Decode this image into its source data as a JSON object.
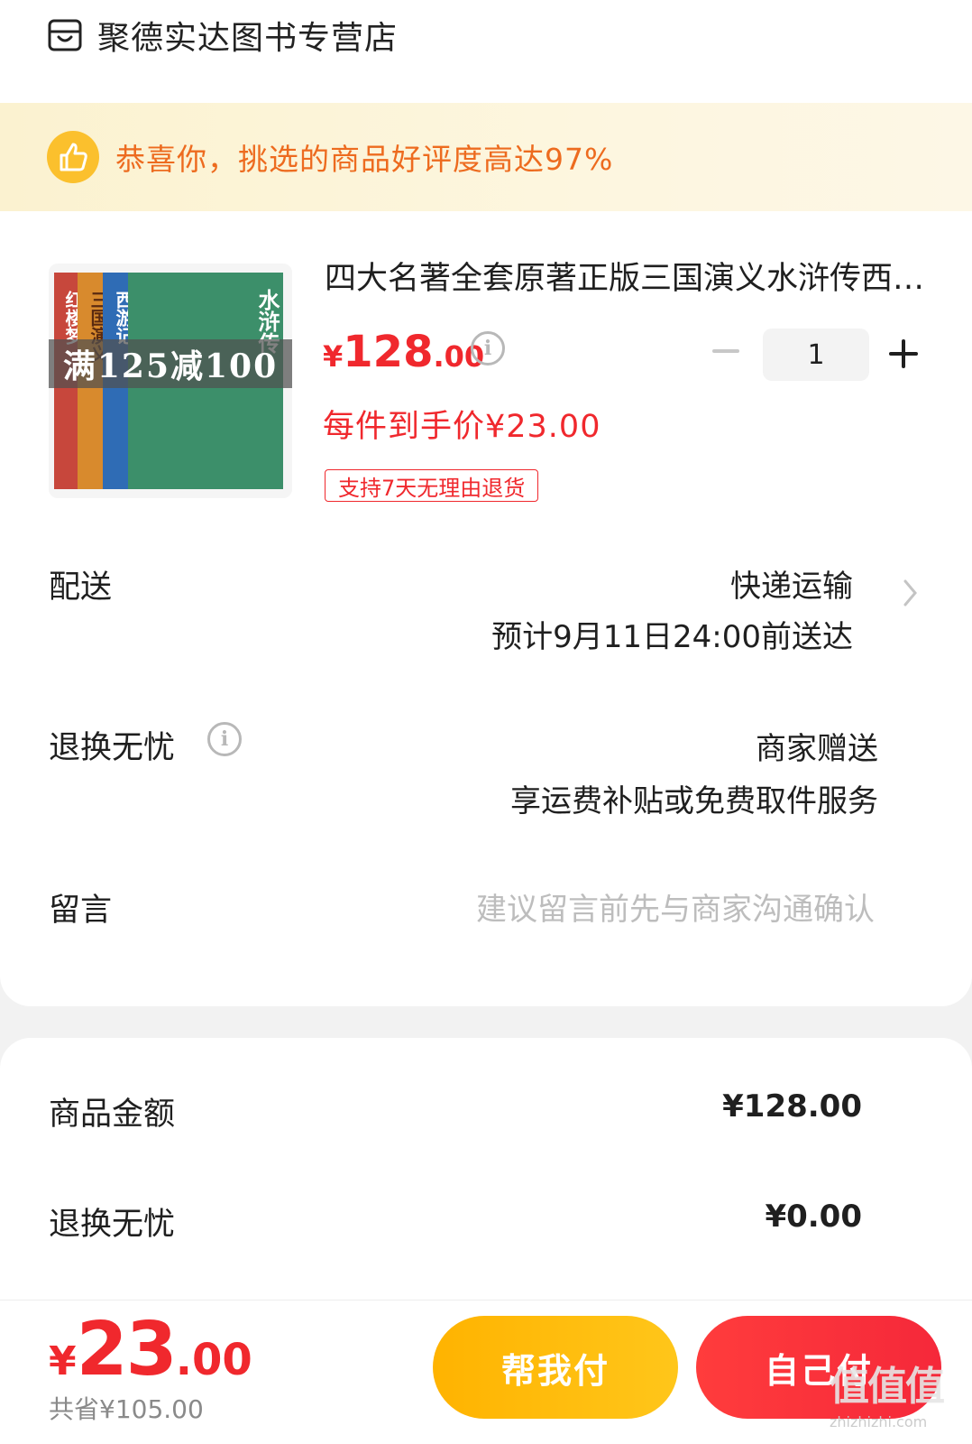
{
  "shop": {
    "name": "聚德实达图书专营店",
    "icon": "store-icon"
  },
  "banner": {
    "text": "恭喜你，挑选的商品好评度高达97%",
    "icon": "thumbs-up-icon"
  },
  "product": {
    "title": "四大名著全套原著正版三国演义水浒传西游记红楼梦",
    "promo_tag": "满125减100",
    "book_titles": [
      "红楼梦",
      "三国演义",
      "西游记",
      "水浒传"
    ],
    "price_symbol": "¥",
    "price_int": "128",
    "price_dec": ".00",
    "price_info_icon": "i",
    "quantity": "1",
    "unit_price_text": "每件到手价¥23.00",
    "return_tag": "支持7天无理由退货"
  },
  "delivery": {
    "label": "配送",
    "method": "快递运输",
    "estimate": "预计9月11日24:00前送达"
  },
  "return_service": {
    "label": "退换无忧",
    "info_icon": "i",
    "value": "商家赠送",
    "detail": "享运费补贴或免费取件服务"
  },
  "message": {
    "label": "留言",
    "placeholder": "建议留言前先与商家沟通确认"
  },
  "summary": {
    "items": [
      {
        "label": "商品金额",
        "value": "¥128.00"
      },
      {
        "label": "退换无忧",
        "value": "¥0.00"
      }
    ]
  },
  "footer": {
    "total_symbol": "¥",
    "total_int": "23",
    "total_dec": ".00",
    "saved": "共省¥105.00",
    "btn_help": "帮我付",
    "btn_self": "自己付"
  },
  "watermark": {
    "logo": "值值值",
    "url": "zhizhizhi.com"
  },
  "colors": {
    "accent_red": "#f0282d",
    "banner_orange": "#ed6b1f",
    "help_button": "#ffb300",
    "self_button": "#f5283a"
  }
}
